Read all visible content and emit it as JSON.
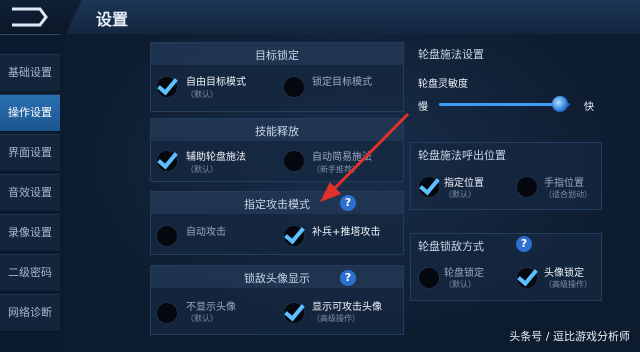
{
  "header": {
    "title": "设置"
  },
  "sidebar": {
    "items": [
      {
        "label": "基础设置",
        "active": false
      },
      {
        "label": "操作设置",
        "active": true
      },
      {
        "label": "界面设置",
        "active": false
      },
      {
        "label": "音效设置",
        "active": false
      },
      {
        "label": "录像设置",
        "active": false
      },
      {
        "label": "二级密码",
        "active": false
      },
      {
        "label": "网络诊断",
        "active": false
      }
    ]
  },
  "target_lock": {
    "title": "目标锁定",
    "options": [
      {
        "label": "自由目标模式",
        "sub": "（默认）",
        "checked": true
      },
      {
        "label": "锁定目标模式",
        "sub": "",
        "checked": false
      }
    ]
  },
  "skill_release": {
    "title": "技能释放",
    "options": [
      {
        "label": "辅助轮盘施法",
        "sub": "（默认）",
        "checked": true
      },
      {
        "label": "自动简易施法",
        "sub": "（新手推荐）",
        "checked": false
      }
    ]
  },
  "attack_mode": {
    "title": "指定攻击模式",
    "help": "?",
    "options": [
      {
        "label": "自动攻击",
        "sub": "",
        "checked": false
      },
      {
        "label": "补兵+推塔攻击",
        "sub": "",
        "checked": true
      }
    ]
  },
  "lock_avatar": {
    "title": "锁敌头像显示",
    "help": "?",
    "options": [
      {
        "label": "不显示头像",
        "sub": "（默认）",
        "checked": false
      },
      {
        "label": "显示可攻击头像",
        "sub": "（高级操作）",
        "checked": true
      }
    ]
  },
  "wheel_settings": {
    "title": "轮盘施法设置",
    "sensitivity_label": "轮盘灵敏度",
    "slow_label": "慢",
    "fast_label": "快",
    "sensitivity": 0.92
  },
  "wheel_position": {
    "title": "轮盘施法呼出位置",
    "options": [
      {
        "label": "指定位置",
        "sub": "（默认）",
        "checked": true
      },
      {
        "label": "手指位置",
        "sub": "（适合划动）",
        "checked": false
      }
    ]
  },
  "wheel_lock": {
    "title": "轮盘锁敌方式",
    "help": "?",
    "options": [
      {
        "label": "轮盘锁定",
        "sub": "（默认）",
        "checked": false
      },
      {
        "label": "头像锁定",
        "sub": "（高级操作）",
        "checked": true
      }
    ]
  },
  "watermark": "头条号 / 逗比游戏分析师",
  "colors": {
    "accent": "#2c6fd0",
    "check": "#5fc0ff",
    "arrow": "#e0322b"
  }
}
